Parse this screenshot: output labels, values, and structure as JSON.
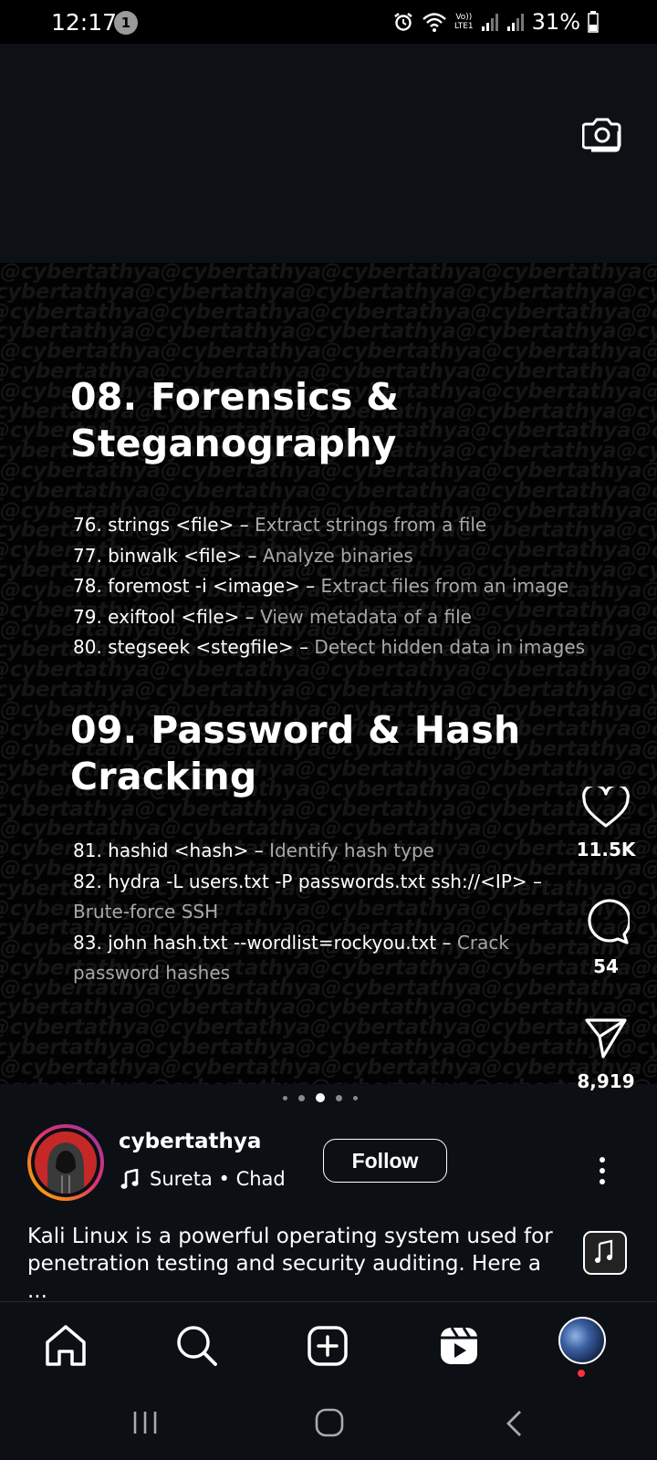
{
  "status_bar": {
    "time": "12:17",
    "notification_count": "1",
    "lte_top": "Vo))",
    "lte_bottom": "LTE1",
    "battery": "31%"
  },
  "post": {
    "watermark_text": "@cybertathya",
    "section1": {
      "title_line1": "08. Forensics &",
      "title_line2": "Steganography",
      "items": [
        {
          "cmd": "76. strings <file> – ",
          "desc": "Extract strings from a file"
        },
        {
          "cmd": "77. binwalk <file> – ",
          "desc": "Analyze binaries"
        },
        {
          "cmd": "78. foremost -i <image> – ",
          "desc": "Extract files from an image"
        },
        {
          "cmd": "79. exiftool <file> – ",
          "desc": "View metadata of a file"
        },
        {
          "cmd": "80. stegseek <stegfile> – ",
          "desc": "Detect hidden data in images"
        }
      ]
    },
    "section2": {
      "title_line1": "09. Password & Hash",
      "title_line2": "Cracking",
      "items": [
        {
          "cmd": "81. hashid <hash> – ",
          "desc": "Identify hash type"
        },
        {
          "cmd": "82. hydra -L users.txt -P passwords.txt ssh://<IP> –",
          "desc": "Brute-force SSH"
        },
        {
          "cmd": "83. john hash.txt --wordlist=rockyou.txt – ",
          "desc": "Crack",
          "desc2": "password hashes"
        }
      ]
    },
    "carousel": {
      "total": 5,
      "active_index": 2
    }
  },
  "actions": {
    "likes": "11.5K",
    "comments": "54",
    "shares": "8,919"
  },
  "author": {
    "username": "cybertathya",
    "audio": "Sureta • Chad",
    "follow_label": "Follow"
  },
  "caption": {
    "line1": "Kali Linux is a powerful operating system used for",
    "line2": "penetration testing and security auditing. Here a ..."
  },
  "colors": {
    "background": "#0c0f14",
    "accent_ring_start": "#f9a602",
    "accent_ring_end": "#833ab4",
    "notification_dot": "#ff3040"
  }
}
